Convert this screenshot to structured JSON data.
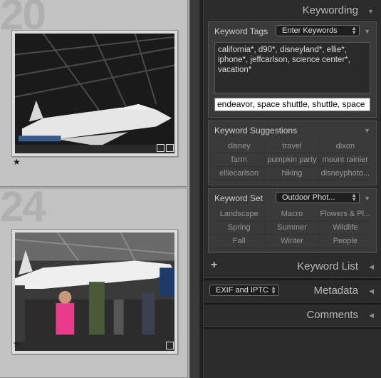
{
  "grid": {
    "cells": [
      {
        "number": "20",
        "rating": "★"
      },
      {
        "number": "24",
        "rating": "★"
      }
    ]
  },
  "panel": {
    "keywording": {
      "title": "Keywording"
    },
    "keyword_tags": {
      "label": "Keyword Tags",
      "dropdown": "Enter Keywords",
      "tags_text": "california*, d90*, disneyland*, ellie*, iphone*, jeffcarlson, science center*, vacation*",
      "input_value": "endeavor, space shuttle, shuttle, space"
    },
    "keyword_suggestions": {
      "label": "Keyword Suggestions",
      "items": [
        "disney",
        "travel",
        "dixon",
        "farm",
        "pumpkin party",
        "mount rainier",
        "elliecarlson",
        "hiking",
        "disneyphoto..."
      ]
    },
    "keyword_set": {
      "label": "Keyword Set",
      "dropdown": "Outdoor Phot...",
      "items": [
        "Landscape",
        "Macro",
        "Flowers & Pl...",
        "Spring",
        "Summer",
        "Wildlife",
        "Fall",
        "Winter",
        "People"
      ]
    },
    "keyword_list": {
      "title": "Keyword List",
      "add": "+"
    },
    "metadata": {
      "title": "Metadata",
      "preset": "EXIF and IPTC"
    },
    "comments": {
      "title": "Comments"
    }
  }
}
